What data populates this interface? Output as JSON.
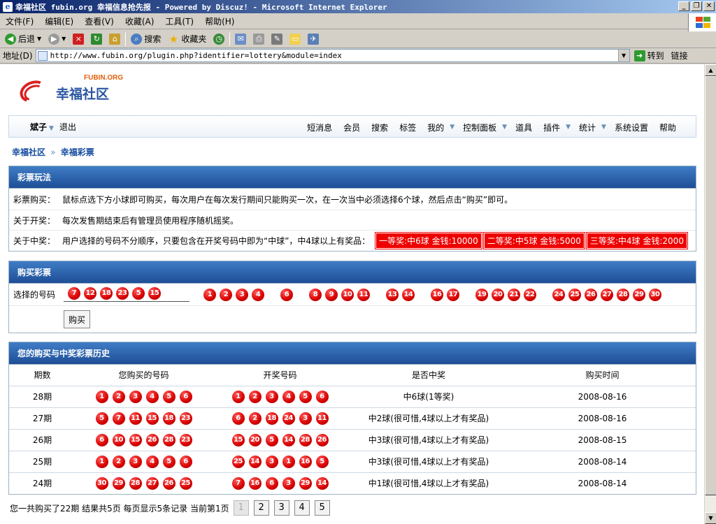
{
  "window": {
    "title": "幸福社区 fubin.org 幸福信息抢先报 - Powered by Discuz! - Microsoft Internet Explorer",
    "buttons": [
      "_",
      "❐",
      "✕"
    ]
  },
  "menu": [
    "文件(F)",
    "编辑(E)",
    "查看(V)",
    "收藏(A)",
    "工具(T)",
    "帮助(H)"
  ],
  "toolbar": {
    "back": "后退",
    "search": "搜索",
    "favorites": "收藏夹"
  },
  "address": {
    "label": "地址(D)",
    "url": "http://www.fubin.org/plugin.php?identifier=lottery&module=index",
    "go": "转到",
    "links": "链接"
  },
  "logo": {
    "en": "FUBIN.ORG",
    "cn": "幸福社区"
  },
  "nav": {
    "user": "斌子",
    "logout": "退出",
    "items": [
      {
        "label": "短消息",
        "caret": false
      },
      {
        "label": "会员",
        "caret": false
      },
      {
        "label": "搜索",
        "caret": false
      },
      {
        "label": "标签",
        "caret": false
      },
      {
        "label": "我的",
        "caret": true
      },
      {
        "label": "控制面板",
        "caret": true
      },
      {
        "label": "道具",
        "caret": false
      },
      {
        "label": "插件",
        "caret": true
      },
      {
        "label": "统计",
        "caret": true
      },
      {
        "label": "系统设置",
        "caret": false
      },
      {
        "label": "帮助",
        "caret": false
      }
    ]
  },
  "breadcrumb": {
    "home": "幸福社区",
    "sep": "»",
    "current": "幸福彩票"
  },
  "rules": {
    "title": "彩票玩法",
    "buy_label": "彩票购买：",
    "buy_text": "鼠标点选下方小球即可购买，每次用户在每次发行期间只能购买一次，在一次当中必须选择6个球，然后点击“购买”即可。",
    "draw_label": "关于开奖：",
    "draw_text": "每次发售期结束后有管理员使用程序随机摇奖。",
    "prize_label": "关于中奖：",
    "prize_text": "用户选择的号码不分顺序，只要包含在开奖号码中即为“中球”，中4球以上有奖品：",
    "prizes": [
      "一等奖:中6球 金钱:10000",
      "二等奖:中5球 金钱:5000",
      "三等奖:中4球 金钱:2000"
    ]
  },
  "purchase": {
    "title": "购买彩票",
    "label": "选择的号码",
    "chosen": [
      "7",
      "12",
      "18",
      "23",
      "5",
      "15"
    ],
    "pool": [
      "1",
      "2",
      "3",
      "4",
      "",
      "6",
      "",
      "8",
      "9",
      "10",
      "11",
      "",
      "13",
      "14",
      "",
      "16",
      "17",
      "",
      "19",
      "20",
      "21",
      "22",
      "",
      "24",
      "25",
      "26",
      "27",
      "28",
      "29",
      "30"
    ],
    "buy_button": "购买"
  },
  "history": {
    "title": "您的购买与中奖彩票历史",
    "headers": [
      "期数",
      "您购买的号码",
      "开奖号码",
      "是否中奖",
      "购买时间"
    ],
    "rows": [
      {
        "period": "28期",
        "bought": [
          "1",
          "2",
          "3",
          "4",
          "5",
          "6"
        ],
        "drawn": [
          "1",
          "2",
          "3",
          "4",
          "5",
          "6"
        ],
        "result": "中6球(1等奖)",
        "date": "2008-08-16"
      },
      {
        "period": "27期",
        "bought": [
          "5",
          "7",
          "11",
          "15",
          "18",
          "23"
        ],
        "drawn": [
          "6",
          "2",
          "18",
          "24",
          "3",
          "11"
        ],
        "result": "中2球(很可惜,4球以上才有奖品)",
        "date": "2008-08-16"
      },
      {
        "period": "26期",
        "bought": [
          "6",
          "10",
          "15",
          "26",
          "28",
          "23"
        ],
        "drawn": [
          "15",
          "20",
          "5",
          "14",
          "28",
          "26"
        ],
        "result": "中3球(很可惜,4球以上才有奖品)",
        "date": "2008-08-15"
      },
      {
        "period": "25期",
        "bought": [
          "1",
          "2",
          "3",
          "4",
          "5",
          "6"
        ],
        "drawn": [
          "25",
          "14",
          "3",
          "1",
          "16",
          "5"
        ],
        "result": "中3球(很可惜,4球以上才有奖品)",
        "date": "2008-08-14"
      },
      {
        "period": "24期",
        "bought": [
          "30",
          "29",
          "28",
          "27",
          "26",
          "25"
        ],
        "drawn": [
          "7",
          "16",
          "6",
          "3",
          "29",
          "14"
        ],
        "result": "中1球(很可惜,4球以上才有奖品)",
        "date": "2008-08-14"
      }
    ]
  },
  "pager": {
    "text": "您一共购买了22期 结果共5页 每页显示5条记录 当前第1页",
    "pages": [
      "1",
      "2",
      "3",
      "4",
      "5"
    ],
    "current": "1"
  },
  "colors": {
    "accent": "#1e4e96",
    "ball": "#d80000",
    "prize": "#ee0000",
    "link": "#154ba0"
  }
}
